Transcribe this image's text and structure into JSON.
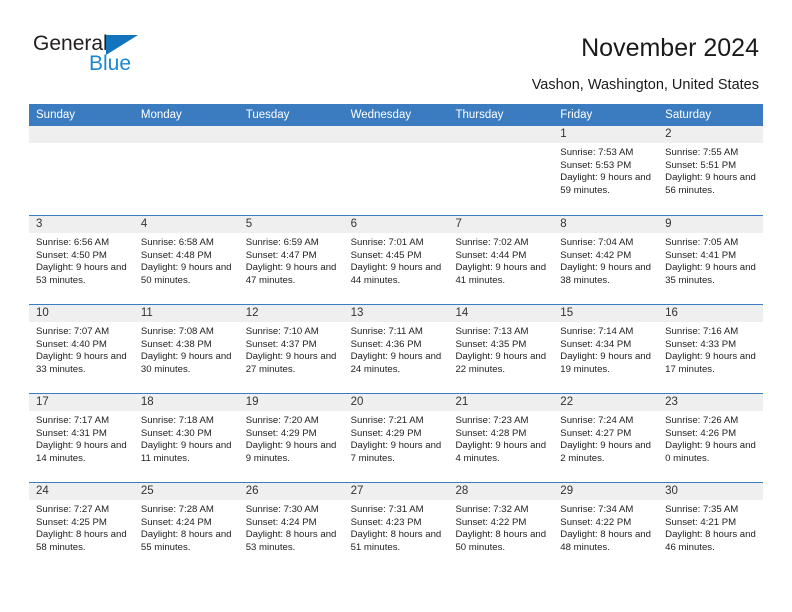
{
  "brand": {
    "line1": "General",
    "line2": "Blue",
    "triangle_icon": "blue-triangle-icon",
    "color_dark": "#231f20",
    "color_blue": "#1b87d4"
  },
  "header": {
    "title": "November 2024",
    "subtitle": "Vashon, Washington, United States"
  },
  "theme": {
    "header_bg": "#3b7cc0",
    "header_text": "#ffffff",
    "day_band_bg": "#efefef",
    "cell_bg": "#ffffff",
    "row_border": "#3b7cc0"
  },
  "calendar": {
    "weekdays": [
      "Sunday",
      "Monday",
      "Tuesday",
      "Wednesday",
      "Thursday",
      "Friday",
      "Saturday"
    ],
    "weeks": [
      [
        {
          "day": "",
          "sunrise": "",
          "sunset": "",
          "daylight": ""
        },
        {
          "day": "",
          "sunrise": "",
          "sunset": "",
          "daylight": ""
        },
        {
          "day": "",
          "sunrise": "",
          "sunset": "",
          "daylight": ""
        },
        {
          "day": "",
          "sunrise": "",
          "sunset": "",
          "daylight": ""
        },
        {
          "day": "",
          "sunrise": "",
          "sunset": "",
          "daylight": ""
        },
        {
          "day": "1",
          "sunrise": "Sunrise: 7:53 AM",
          "sunset": "Sunset: 5:53 PM",
          "daylight": "Daylight: 9 hours and 59 minutes."
        },
        {
          "day": "2",
          "sunrise": "Sunrise: 7:55 AM",
          "sunset": "Sunset: 5:51 PM",
          "daylight": "Daylight: 9 hours and 56 minutes."
        }
      ],
      [
        {
          "day": "3",
          "sunrise": "Sunrise: 6:56 AM",
          "sunset": "Sunset: 4:50 PM",
          "daylight": "Daylight: 9 hours and 53 minutes."
        },
        {
          "day": "4",
          "sunrise": "Sunrise: 6:58 AM",
          "sunset": "Sunset: 4:48 PM",
          "daylight": "Daylight: 9 hours and 50 minutes."
        },
        {
          "day": "5",
          "sunrise": "Sunrise: 6:59 AM",
          "sunset": "Sunset: 4:47 PM",
          "daylight": "Daylight: 9 hours and 47 minutes."
        },
        {
          "day": "6",
          "sunrise": "Sunrise: 7:01 AM",
          "sunset": "Sunset: 4:45 PM",
          "daylight": "Daylight: 9 hours and 44 minutes."
        },
        {
          "day": "7",
          "sunrise": "Sunrise: 7:02 AM",
          "sunset": "Sunset: 4:44 PM",
          "daylight": "Daylight: 9 hours and 41 minutes."
        },
        {
          "day": "8",
          "sunrise": "Sunrise: 7:04 AM",
          "sunset": "Sunset: 4:42 PM",
          "daylight": "Daylight: 9 hours and 38 minutes."
        },
        {
          "day": "9",
          "sunrise": "Sunrise: 7:05 AM",
          "sunset": "Sunset: 4:41 PM",
          "daylight": "Daylight: 9 hours and 35 minutes."
        }
      ],
      [
        {
          "day": "10",
          "sunrise": "Sunrise: 7:07 AM",
          "sunset": "Sunset: 4:40 PM",
          "daylight": "Daylight: 9 hours and 33 minutes."
        },
        {
          "day": "11",
          "sunrise": "Sunrise: 7:08 AM",
          "sunset": "Sunset: 4:38 PM",
          "daylight": "Daylight: 9 hours and 30 minutes."
        },
        {
          "day": "12",
          "sunrise": "Sunrise: 7:10 AM",
          "sunset": "Sunset: 4:37 PM",
          "daylight": "Daylight: 9 hours and 27 minutes."
        },
        {
          "day": "13",
          "sunrise": "Sunrise: 7:11 AM",
          "sunset": "Sunset: 4:36 PM",
          "daylight": "Daylight: 9 hours and 24 minutes."
        },
        {
          "day": "14",
          "sunrise": "Sunrise: 7:13 AM",
          "sunset": "Sunset: 4:35 PM",
          "daylight": "Daylight: 9 hours and 22 minutes."
        },
        {
          "day": "15",
          "sunrise": "Sunrise: 7:14 AM",
          "sunset": "Sunset: 4:34 PM",
          "daylight": "Daylight: 9 hours and 19 minutes."
        },
        {
          "day": "16",
          "sunrise": "Sunrise: 7:16 AM",
          "sunset": "Sunset: 4:33 PM",
          "daylight": "Daylight: 9 hours and 17 minutes."
        }
      ],
      [
        {
          "day": "17",
          "sunrise": "Sunrise: 7:17 AM",
          "sunset": "Sunset: 4:31 PM",
          "daylight": "Daylight: 9 hours and 14 minutes."
        },
        {
          "day": "18",
          "sunrise": "Sunrise: 7:18 AM",
          "sunset": "Sunset: 4:30 PM",
          "daylight": "Daylight: 9 hours and 11 minutes."
        },
        {
          "day": "19",
          "sunrise": "Sunrise: 7:20 AM",
          "sunset": "Sunset: 4:29 PM",
          "daylight": "Daylight: 9 hours and 9 minutes."
        },
        {
          "day": "20",
          "sunrise": "Sunrise: 7:21 AM",
          "sunset": "Sunset: 4:29 PM",
          "daylight": "Daylight: 9 hours and 7 minutes."
        },
        {
          "day": "21",
          "sunrise": "Sunrise: 7:23 AM",
          "sunset": "Sunset: 4:28 PM",
          "daylight": "Daylight: 9 hours and 4 minutes."
        },
        {
          "day": "22",
          "sunrise": "Sunrise: 7:24 AM",
          "sunset": "Sunset: 4:27 PM",
          "daylight": "Daylight: 9 hours and 2 minutes."
        },
        {
          "day": "23",
          "sunrise": "Sunrise: 7:26 AM",
          "sunset": "Sunset: 4:26 PM",
          "daylight": "Daylight: 9 hours and 0 minutes."
        }
      ],
      [
        {
          "day": "24",
          "sunrise": "Sunrise: 7:27 AM",
          "sunset": "Sunset: 4:25 PM",
          "daylight": "Daylight: 8 hours and 58 minutes."
        },
        {
          "day": "25",
          "sunrise": "Sunrise: 7:28 AM",
          "sunset": "Sunset: 4:24 PM",
          "daylight": "Daylight: 8 hours and 55 minutes."
        },
        {
          "day": "26",
          "sunrise": "Sunrise: 7:30 AM",
          "sunset": "Sunset: 4:24 PM",
          "daylight": "Daylight: 8 hours and 53 minutes."
        },
        {
          "day": "27",
          "sunrise": "Sunrise: 7:31 AM",
          "sunset": "Sunset: 4:23 PM",
          "daylight": "Daylight: 8 hours and 51 minutes."
        },
        {
          "day": "28",
          "sunrise": "Sunrise: 7:32 AM",
          "sunset": "Sunset: 4:22 PM",
          "daylight": "Daylight: 8 hours and 50 minutes."
        },
        {
          "day": "29",
          "sunrise": "Sunrise: 7:34 AM",
          "sunset": "Sunset: 4:22 PM",
          "daylight": "Daylight: 8 hours and 48 minutes."
        },
        {
          "day": "30",
          "sunrise": "Sunrise: 7:35 AM",
          "sunset": "Sunset: 4:21 PM",
          "daylight": "Daylight: 8 hours and 46 minutes."
        }
      ]
    ]
  }
}
